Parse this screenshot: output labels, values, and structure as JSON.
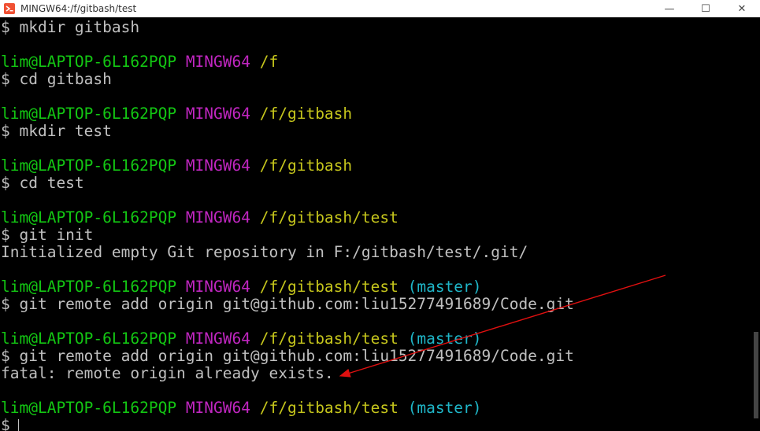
{
  "window": {
    "title": "MINGW64:/f/gitbash/test",
    "minimize_glyph": "—",
    "maximize_glyph": "☐",
    "close_glyph": "✕"
  },
  "colors": {
    "user": "#13c713",
    "system": "#c026c0",
    "path": "#c5c51c",
    "branch": "#1fb6c8",
    "text": "#c0c0c0",
    "annotation_arrow": "#e01010"
  },
  "terminal": {
    "lines": [
      {
        "type": "cmd",
        "text": "$ mkdir gitbash"
      },
      {
        "type": "blank"
      },
      {
        "type": "prompt",
        "user": "lim@LAPTOP-6L162PQP",
        "system": "MINGW64",
        "path": "/f",
        "branch": ""
      },
      {
        "type": "cmd",
        "text": "$ cd gitbash"
      },
      {
        "type": "blank"
      },
      {
        "type": "prompt",
        "user": "lim@LAPTOP-6L162PQP",
        "system": "MINGW64",
        "path": "/f/gitbash",
        "branch": ""
      },
      {
        "type": "cmd",
        "text": "$ mkdir test"
      },
      {
        "type": "blank"
      },
      {
        "type": "prompt",
        "user": "lim@LAPTOP-6L162PQP",
        "system": "MINGW64",
        "path": "/f/gitbash",
        "branch": ""
      },
      {
        "type": "cmd",
        "text": "$ cd test"
      },
      {
        "type": "blank"
      },
      {
        "type": "prompt",
        "user": "lim@LAPTOP-6L162PQP",
        "system": "MINGW64",
        "path": "/f/gitbash/test",
        "branch": ""
      },
      {
        "type": "cmd",
        "text": "$ git init"
      },
      {
        "type": "out",
        "text": "Initialized empty Git repository in F:/gitbash/test/.git/"
      },
      {
        "type": "blank"
      },
      {
        "type": "prompt",
        "user": "lim@LAPTOP-6L162PQP",
        "system": "MINGW64",
        "path": "/f/gitbash/test",
        "branch": "(master)"
      },
      {
        "type": "cmd",
        "text": "$ git remote add origin git@github.com:liu15277491689/Code.git"
      },
      {
        "type": "blank"
      },
      {
        "type": "prompt",
        "user": "lim@LAPTOP-6L162PQP",
        "system": "MINGW64",
        "path": "/f/gitbash/test",
        "branch": "(master)"
      },
      {
        "type": "cmd",
        "text": "$ git remote add origin git@github.com:liu15277491689/Code.git"
      },
      {
        "type": "out",
        "text": "fatal: remote origin already exists."
      },
      {
        "type": "blank"
      },
      {
        "type": "prompt",
        "user": "lim@LAPTOP-6L162PQP",
        "system": "MINGW64",
        "path": "/f/gitbash/test",
        "branch": "(master)"
      },
      {
        "type": "input",
        "text": "$"
      }
    ]
  }
}
